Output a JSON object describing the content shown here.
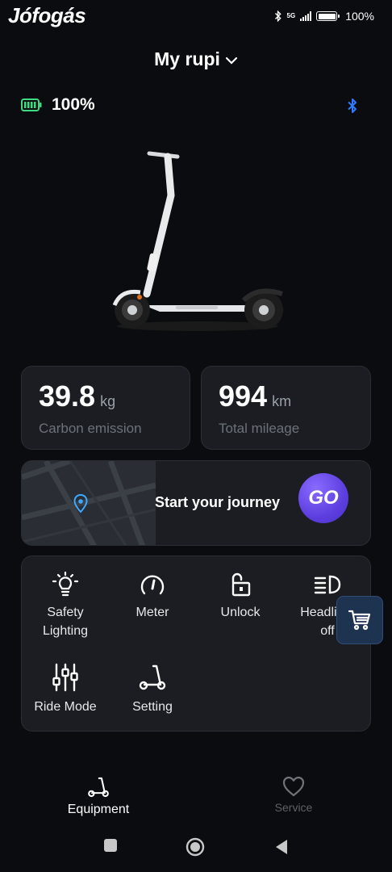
{
  "watermark": "Jófogás",
  "status": {
    "network": "5G",
    "battery": "100%"
  },
  "header": {
    "title": "My rupi"
  },
  "device": {
    "battery": "100%"
  },
  "stats": [
    {
      "value": "39.8",
      "unit": "kg",
      "label": "Carbon emission"
    },
    {
      "value": "994",
      "unit": "km",
      "label": "Total mileage"
    }
  ],
  "journey": {
    "label": "Start your journey",
    "go": "GO"
  },
  "functions": [
    {
      "label": "Safety\nLighting",
      "icon": "bulb-icon"
    },
    {
      "label": "Meter",
      "icon": "gauge-icon"
    },
    {
      "label": "Unlock",
      "icon": "unlock-icon"
    },
    {
      "label": "Headlight\noff",
      "icon": "headlight-icon"
    },
    {
      "label": "Ride Mode",
      "icon": "sliders-icon"
    },
    {
      "label": "Setting",
      "icon": "scooter-icon"
    }
  ],
  "nav": [
    {
      "label": "Equipment",
      "active": true
    },
    {
      "label": "Service",
      "active": false
    }
  ],
  "colors": {
    "accent": "#5d3fe0",
    "battery": "#3ddc84",
    "bluetooth": "#2f7bff",
    "background": "#0b0c0f",
    "card": "#1b1d22"
  }
}
